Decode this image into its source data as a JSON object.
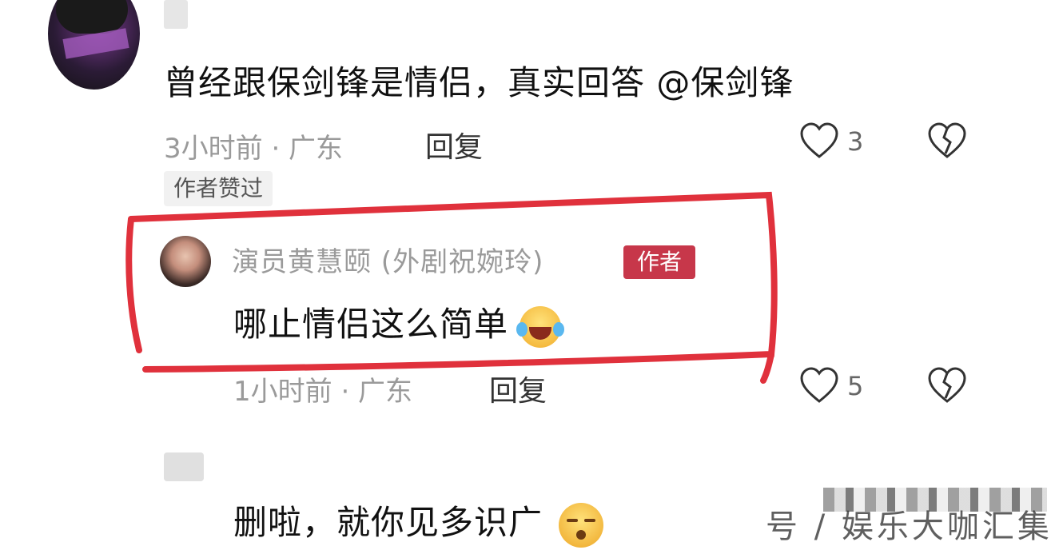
{
  "comment1": {
    "text": "曾经跟保剑锋是情侣，真实回答 @保剑锋",
    "time": "3小时前 · 广东",
    "reply_label": "回复",
    "like_count": "3",
    "liked_by_author": "作者赞过"
  },
  "reply1": {
    "author_name": "演员黄慧颐 (外剧祝婉玲)",
    "author_badge": "作者",
    "text": "哪止情侣这么简单",
    "time": "1小时前 · 广东",
    "reply_label": "回复",
    "like_count": "5"
  },
  "comment2": {
    "text": "删啦，就你见多识广"
  },
  "watermark": {
    "text": "号 / 娱乐大咖汇集"
  },
  "colors": {
    "highlight_red": "#e0313c",
    "author_badge": "#c7374a",
    "meta_gray": "#9a9a9a"
  }
}
